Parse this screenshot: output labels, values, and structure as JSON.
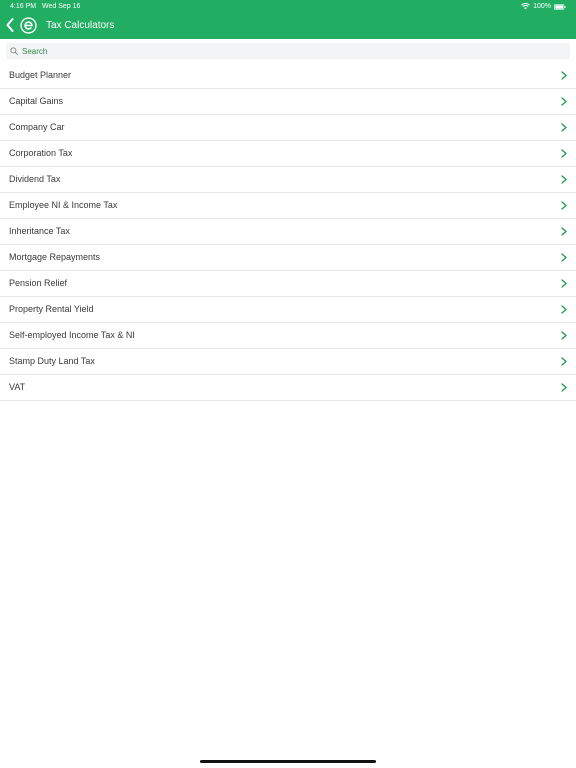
{
  "status_bar": {
    "time": "4:16 PM",
    "date": "Wed Sep 16",
    "battery": "100%"
  },
  "nav": {
    "title": "Tax Calculators"
  },
  "search": {
    "placeholder": "Search"
  },
  "calculators": [
    "Budget Planner",
    "Capital Gains",
    "Company Car",
    "Corporation Tax",
    "Dividend Tax",
    "Employee NI & Income Tax",
    "Inheritance Tax",
    "Mortgage Repayments",
    "Pension Relief",
    "Property Rental Yield",
    "Self-employed Income Tax & NI",
    "Stamp Duty Land Tax",
    "VAT"
  ],
  "icons": {
    "back": "chevron-left-icon",
    "logo": "app-logo-icon",
    "search": "search-icon",
    "row": "chevron-right-icon",
    "wifi": "wifi-icon",
    "battery": "battery-icon"
  },
  "colors": {
    "brand_green": "#21ad62",
    "chevron_green": "#1f9b52",
    "search_placeholder": "#36884f",
    "search_bg": "#f2f4f6",
    "divider": "#e6e6e6"
  }
}
